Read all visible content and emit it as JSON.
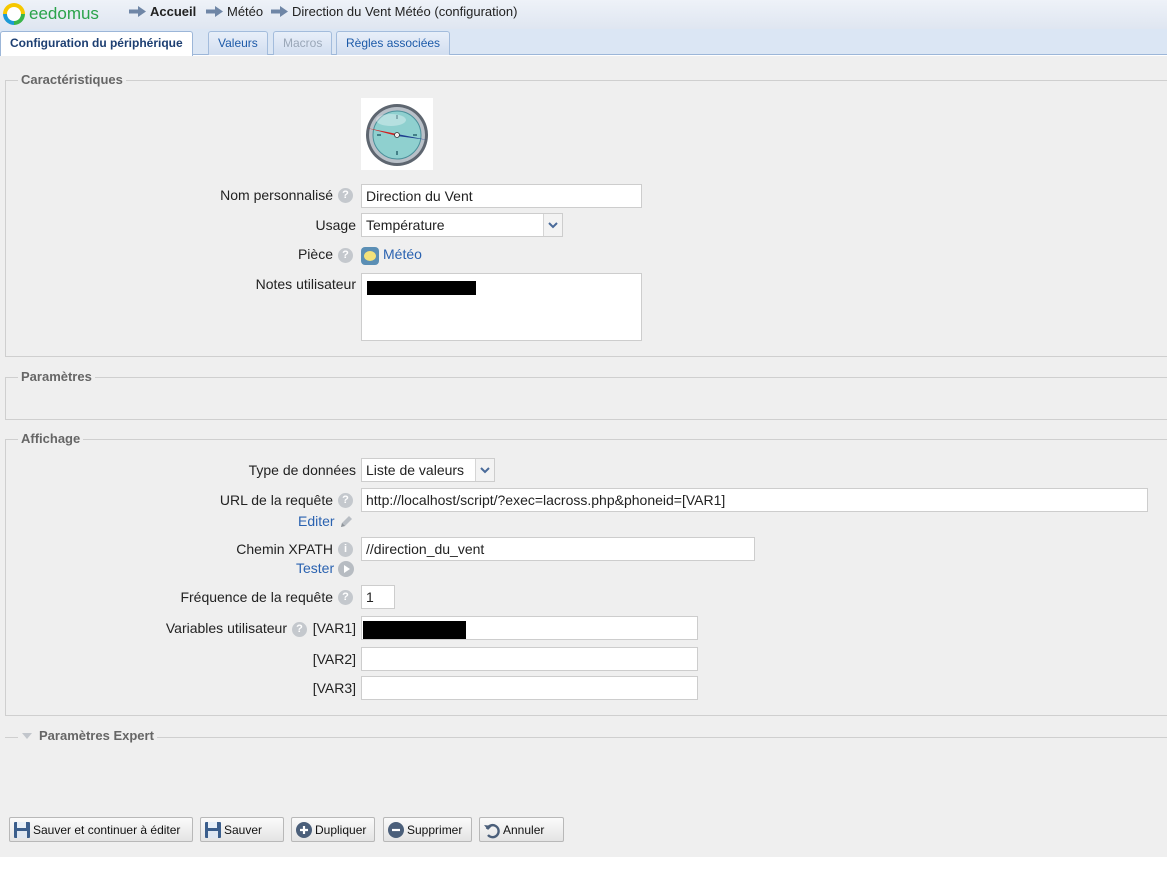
{
  "app": {
    "logo_text": "eedomus"
  },
  "breadcrumb": [
    {
      "label": "Accueil"
    },
    {
      "label": "Météo"
    },
    {
      "label": "Direction du Vent Météo (configuration)"
    }
  ],
  "tabs": [
    {
      "label": "Configuration du périphérique",
      "state": "active"
    },
    {
      "label": "Valeurs",
      "state": "normal"
    },
    {
      "label": "Macros",
      "state": "disabled"
    },
    {
      "label": "Règles associées",
      "state": "normal"
    }
  ],
  "caracteristiques": {
    "legend": "Caractéristiques",
    "nom_label": "Nom personnalisé",
    "nom_value": "Direction du Vent",
    "usage_label": "Usage",
    "usage_value": "Température",
    "piece_label": "Pièce",
    "piece_value": "Météo",
    "notes_label": "Notes utilisateur"
  },
  "parametres": {
    "legend": "Paramètres"
  },
  "affichage": {
    "legend": "Affichage",
    "type_label": "Type de données",
    "type_value": "Liste de valeurs",
    "url_label": "URL de la requête",
    "url_value": "http://localhost/script/?exec=lacross.php&phoneid=[VAR1]",
    "editer_link": "Editer",
    "xpath_label": "Chemin XPATH",
    "xpath_value": "//direction_du_vent",
    "tester_link": "Tester",
    "freq_label": "Fréquence de la requête",
    "freq_value": "1",
    "vars_label": "Variables utilisateur",
    "var1_label": "[VAR1]",
    "var2_label": "[VAR2]",
    "var3_label": "[VAR3]",
    "var2_value": "",
    "var3_value": ""
  },
  "expert": {
    "legend": "Paramètres Expert"
  },
  "buttons": {
    "save_continue": "Sauver et continuer à éditer",
    "save": "Sauver",
    "duplicate": "Dupliquer",
    "delete": "Supprimer",
    "cancel": "Annuler"
  },
  "colors": {
    "link": "#2a62b0",
    "tab_active": "#1d3f72",
    "logo_green": "#2aa34a",
    "panel_bg": "#efefef"
  }
}
